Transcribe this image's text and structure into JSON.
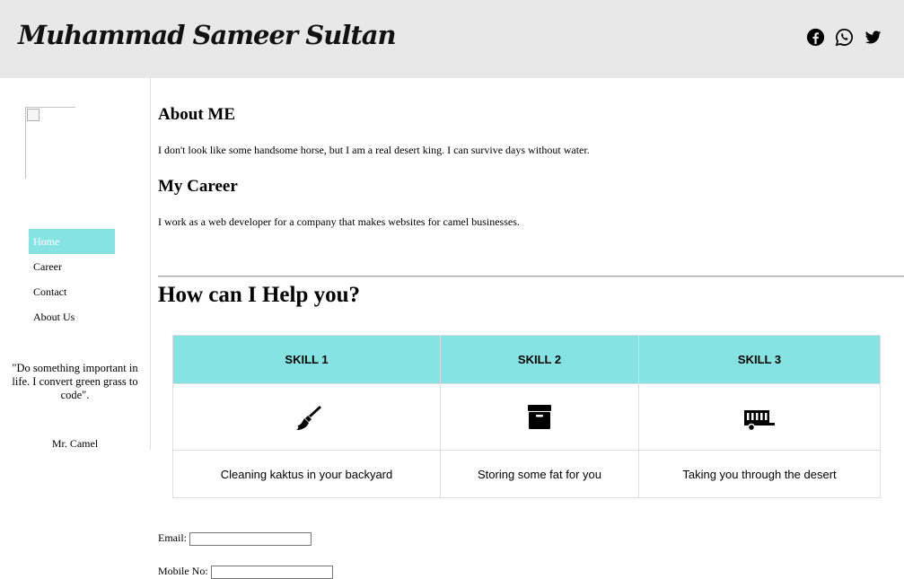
{
  "header": {
    "title": "Muhammad Sameer Sultan",
    "social": [
      {
        "icon": "facebook-icon"
      },
      {
        "icon": "whatsapp-icon"
      },
      {
        "icon": "twitter-icon"
      }
    ]
  },
  "sidebar": {
    "nav": [
      {
        "label": "Home",
        "active": true
      },
      {
        "label": "Career",
        "active": false
      },
      {
        "label": "Contact",
        "active": false
      },
      {
        "label": "About Us",
        "active": false
      }
    ],
    "quote": "\"Do something important in life. I convert green grass to code\".",
    "quote_author": "Mr. Camel"
  },
  "about": {
    "heading": "About ME",
    "text": "I don't look like some handsome horse, but I am a real desert king. I can survive days without water."
  },
  "career": {
    "heading": "My Career",
    "text": "I work as a web developer for a company that makes websites for camel businesses."
  },
  "help": {
    "heading": "How can I Help you?",
    "skills": [
      {
        "title": "SKILL 1",
        "icon": "broom-icon",
        "description": "Cleaning kaktus in your backyard"
      },
      {
        "title": "SKILL 2",
        "icon": "archive-box-icon",
        "description": "Storing some fat for you"
      },
      {
        "title": "SKILL 3",
        "icon": "trailer-icon",
        "description": "Taking you through the desert"
      }
    ]
  },
  "form": {
    "email_label": "Email:",
    "email_value": "",
    "mobile_label": "Mobile No:",
    "mobile_value": ""
  },
  "colors": {
    "accent": "#86e3e3",
    "header_bg": "#e8e8e8"
  }
}
